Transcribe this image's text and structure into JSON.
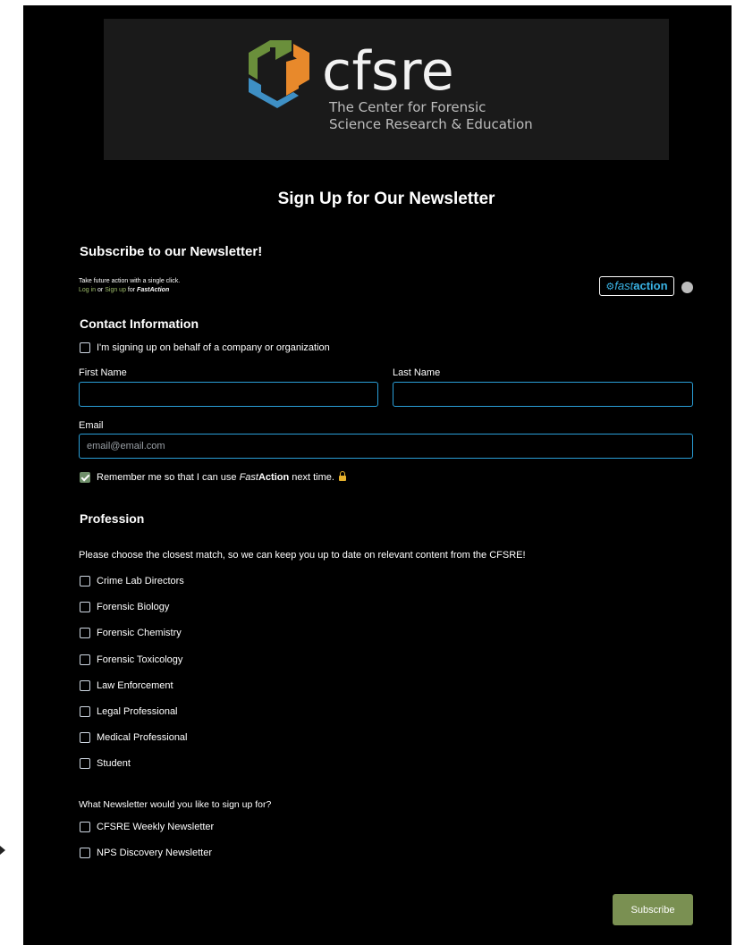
{
  "brand": {
    "wordmark": "cfsre",
    "tagline_line1": "The Center for Forensic",
    "tagline_line2": "Science Research & Education",
    "colors": {
      "green": "#6a8f3b",
      "orange": "#e8892b",
      "blue": "#3e8fc4"
    }
  },
  "page_title": "Sign Up for Our Newsletter",
  "subscribe_heading": "Subscribe to our Newsletter!",
  "fastaction": {
    "line1": "Take future action with a single click.",
    "login": "Log in",
    "or": "or",
    "signup": "Sign up",
    "for": "for",
    "name": "FastAction",
    "badge_fast": "fast",
    "badge_action": "action",
    "badge_icon": "gear-icon",
    "badge_color": "#3ab4e6"
  },
  "contact": {
    "heading": "Contact Information",
    "org_checkbox_label": "I'm signing up on behalf of a company or organization",
    "first_name_label": "First Name",
    "last_name_label": "Last Name",
    "first_name_value": "",
    "last_name_value": "",
    "email_label": "Email",
    "email_value": "",
    "email_placeholder": "email@email.com",
    "remember_prefix": "Remember me so that I can use",
    "remember_fast": "Fast",
    "remember_action": "Action",
    "remember_suffix": "next time.",
    "remember_checked": true
  },
  "profession": {
    "heading": "Profession",
    "prompt": "Please choose the closest match, so we can keep you up to date on relevant content from the CFSRE!",
    "options": [
      "Crime Lab Directors",
      "Forensic Biology",
      "Forensic Chemistry",
      "Forensic Toxicology",
      "Law Enforcement",
      "Legal Professional",
      "Medical Professional",
      "Student"
    ]
  },
  "newsletters": {
    "prompt": "What Newsletter would you like to sign up for?",
    "options": [
      "CFSRE Weekly Newsletter",
      "NPS Discovery Newsletter"
    ]
  },
  "subscribe_button": "Subscribe",
  "accent_colors": {
    "input_border": "#2a9fd8",
    "button": "#7a9052",
    "checkbox_checked": "#6f8f6a"
  }
}
